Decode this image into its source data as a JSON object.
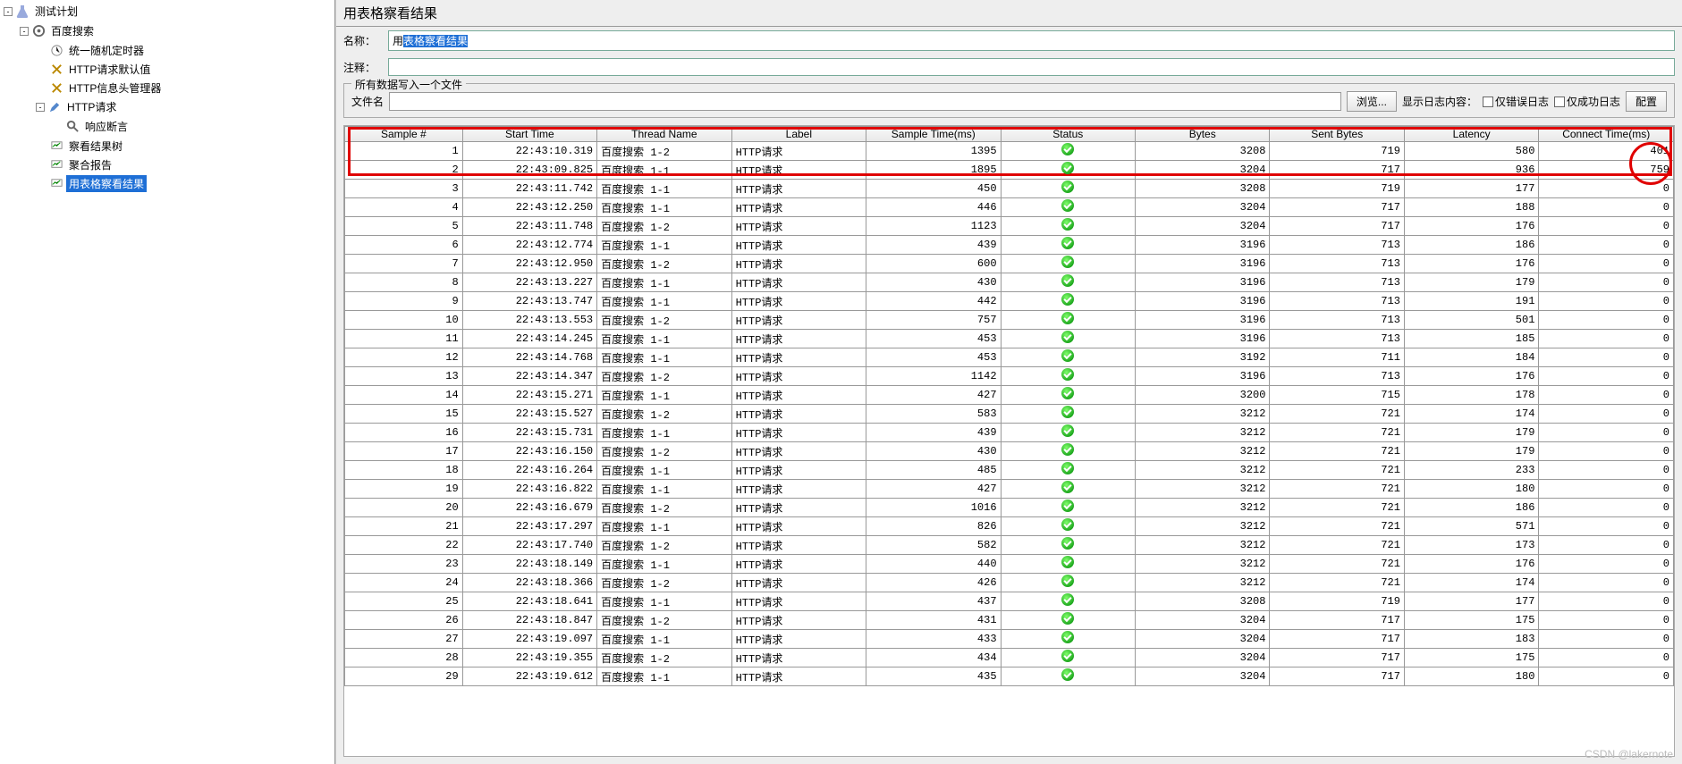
{
  "tree": {
    "root": "测试计划",
    "n1": "百度搜索",
    "n2": "统一随机定时器",
    "n3": "HTTP请求默认值",
    "n4": "HTTP信息头管理器",
    "n5": "HTTP请求",
    "n6": "响应断言",
    "n7": "察看结果树",
    "n8": "聚合报告",
    "n9": "用表格察看结果"
  },
  "panel": {
    "title": "用表格察看结果",
    "name_label": "名称：",
    "name_prefix": "用",
    "name_sel": "表格察看结果",
    "comment_label": "注释：",
    "comment_value": "",
    "file_group_title": "所有数据写入一个文件",
    "file_label": "文件名",
    "file_value": "",
    "browse": "浏览...",
    "log_label": "显示日志内容：",
    "only_err": "仅错误日志",
    "only_ok": "仅成功日志",
    "config": "配置"
  },
  "columns": [
    "Sample #",
    "Start Time",
    "Thread Name",
    "Label",
    "Sample Time(ms)",
    "Status",
    "Bytes",
    "Sent Bytes",
    "Latency",
    "Connect Time(ms)"
  ],
  "rows": [
    {
      "n": 1,
      "t": "22:43:10.319",
      "th": "百度搜索 1-2",
      "l": "HTTP请求",
      "st": 1395,
      "ok": true,
      "b": 3208,
      "sb": 719,
      "lat": 580,
      "ct": 401
    },
    {
      "n": 2,
      "t": "22:43:09.825",
      "th": "百度搜索 1-1",
      "l": "HTTP请求",
      "st": 1895,
      "ok": true,
      "b": 3204,
      "sb": 717,
      "lat": 936,
      "ct": 759
    },
    {
      "n": 3,
      "t": "22:43:11.742",
      "th": "百度搜索 1-1",
      "l": "HTTP请求",
      "st": 450,
      "ok": true,
      "b": 3208,
      "sb": 719,
      "lat": 177,
      "ct": 0
    },
    {
      "n": 4,
      "t": "22:43:12.250",
      "th": "百度搜索 1-1",
      "l": "HTTP请求",
      "st": 446,
      "ok": true,
      "b": 3204,
      "sb": 717,
      "lat": 188,
      "ct": 0
    },
    {
      "n": 5,
      "t": "22:43:11.748",
      "th": "百度搜索 1-2",
      "l": "HTTP请求",
      "st": 1123,
      "ok": true,
      "b": 3204,
      "sb": 717,
      "lat": 176,
      "ct": 0
    },
    {
      "n": 6,
      "t": "22:43:12.774",
      "th": "百度搜索 1-1",
      "l": "HTTP请求",
      "st": 439,
      "ok": true,
      "b": 3196,
      "sb": 713,
      "lat": 186,
      "ct": 0
    },
    {
      "n": 7,
      "t": "22:43:12.950",
      "th": "百度搜索 1-2",
      "l": "HTTP请求",
      "st": 600,
      "ok": true,
      "b": 3196,
      "sb": 713,
      "lat": 176,
      "ct": 0
    },
    {
      "n": 8,
      "t": "22:43:13.227",
      "th": "百度搜索 1-1",
      "l": "HTTP请求",
      "st": 430,
      "ok": true,
      "b": 3196,
      "sb": 713,
      "lat": 179,
      "ct": 0
    },
    {
      "n": 9,
      "t": "22:43:13.747",
      "th": "百度搜索 1-1",
      "l": "HTTP请求",
      "st": 442,
      "ok": true,
      "b": 3196,
      "sb": 713,
      "lat": 191,
      "ct": 0
    },
    {
      "n": 10,
      "t": "22:43:13.553",
      "th": "百度搜索 1-2",
      "l": "HTTP请求",
      "st": 757,
      "ok": true,
      "b": 3196,
      "sb": 713,
      "lat": 501,
      "ct": 0
    },
    {
      "n": 11,
      "t": "22:43:14.245",
      "th": "百度搜索 1-1",
      "l": "HTTP请求",
      "st": 453,
      "ok": true,
      "b": 3196,
      "sb": 713,
      "lat": 185,
      "ct": 0
    },
    {
      "n": 12,
      "t": "22:43:14.768",
      "th": "百度搜索 1-1",
      "l": "HTTP请求",
      "st": 453,
      "ok": true,
      "b": 3192,
      "sb": 711,
      "lat": 184,
      "ct": 0
    },
    {
      "n": 13,
      "t": "22:43:14.347",
      "th": "百度搜索 1-2",
      "l": "HTTP请求",
      "st": 1142,
      "ok": true,
      "b": 3196,
      "sb": 713,
      "lat": 176,
      "ct": 0
    },
    {
      "n": 14,
      "t": "22:43:15.271",
      "th": "百度搜索 1-1",
      "l": "HTTP请求",
      "st": 427,
      "ok": true,
      "b": 3200,
      "sb": 715,
      "lat": 178,
      "ct": 0
    },
    {
      "n": 15,
      "t": "22:43:15.527",
      "th": "百度搜索 1-2",
      "l": "HTTP请求",
      "st": 583,
      "ok": true,
      "b": 3212,
      "sb": 721,
      "lat": 174,
      "ct": 0
    },
    {
      "n": 16,
      "t": "22:43:15.731",
      "th": "百度搜索 1-1",
      "l": "HTTP请求",
      "st": 439,
      "ok": true,
      "b": 3212,
      "sb": 721,
      "lat": 179,
      "ct": 0
    },
    {
      "n": 17,
      "t": "22:43:16.150",
      "th": "百度搜索 1-2",
      "l": "HTTP请求",
      "st": 430,
      "ok": true,
      "b": 3212,
      "sb": 721,
      "lat": 179,
      "ct": 0
    },
    {
      "n": 18,
      "t": "22:43:16.264",
      "th": "百度搜索 1-1",
      "l": "HTTP请求",
      "st": 485,
      "ok": true,
      "b": 3212,
      "sb": 721,
      "lat": 233,
      "ct": 0
    },
    {
      "n": 19,
      "t": "22:43:16.822",
      "th": "百度搜索 1-1",
      "l": "HTTP请求",
      "st": 427,
      "ok": true,
      "b": 3212,
      "sb": 721,
      "lat": 180,
      "ct": 0
    },
    {
      "n": 20,
      "t": "22:43:16.679",
      "th": "百度搜索 1-2",
      "l": "HTTP请求",
      "st": 1016,
      "ok": true,
      "b": 3212,
      "sb": 721,
      "lat": 186,
      "ct": 0
    },
    {
      "n": 21,
      "t": "22:43:17.297",
      "th": "百度搜索 1-1",
      "l": "HTTP请求",
      "st": 826,
      "ok": true,
      "b": 3212,
      "sb": 721,
      "lat": 571,
      "ct": 0
    },
    {
      "n": 22,
      "t": "22:43:17.740",
      "th": "百度搜索 1-2",
      "l": "HTTP请求",
      "st": 582,
      "ok": true,
      "b": 3212,
      "sb": 721,
      "lat": 173,
      "ct": 0
    },
    {
      "n": 23,
      "t": "22:43:18.149",
      "th": "百度搜索 1-1",
      "l": "HTTP请求",
      "st": 440,
      "ok": true,
      "b": 3212,
      "sb": 721,
      "lat": 176,
      "ct": 0
    },
    {
      "n": 24,
      "t": "22:43:18.366",
      "th": "百度搜索 1-2",
      "l": "HTTP请求",
      "st": 426,
      "ok": true,
      "b": 3212,
      "sb": 721,
      "lat": 174,
      "ct": 0
    },
    {
      "n": 25,
      "t": "22:43:18.641",
      "th": "百度搜索 1-1",
      "l": "HTTP请求",
      "st": 437,
      "ok": true,
      "b": 3208,
      "sb": 719,
      "lat": 177,
      "ct": 0
    },
    {
      "n": 26,
      "t": "22:43:18.847",
      "th": "百度搜索 1-2",
      "l": "HTTP请求",
      "st": 431,
      "ok": true,
      "b": 3204,
      "sb": 717,
      "lat": 175,
      "ct": 0
    },
    {
      "n": 27,
      "t": "22:43:19.097",
      "th": "百度搜索 1-1",
      "l": "HTTP请求",
      "st": 433,
      "ok": true,
      "b": 3204,
      "sb": 717,
      "lat": 183,
      "ct": 0
    },
    {
      "n": 28,
      "t": "22:43:19.355",
      "th": "百度搜索 1-2",
      "l": "HTTP请求",
      "st": 434,
      "ok": true,
      "b": 3204,
      "sb": 717,
      "lat": 175,
      "ct": 0
    },
    {
      "n": 29,
      "t": "22:43:19.612",
      "th": "百度搜索 1-1",
      "l": "HTTP请求",
      "st": 435,
      "ok": true,
      "b": 3204,
      "sb": 717,
      "lat": 180,
      "ct": 0
    }
  ],
  "watermark": "CSDN @lakernote"
}
